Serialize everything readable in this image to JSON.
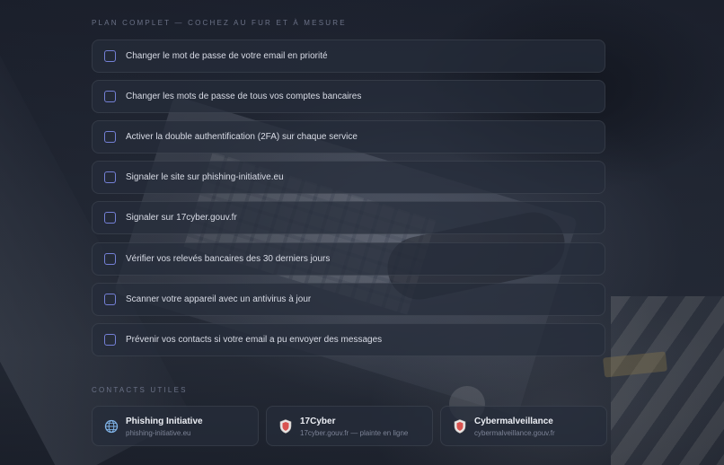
{
  "plan": {
    "title": "PLAN COMPLET — COCHEZ AU FUR ET À MESURE",
    "tasks": [
      {
        "label": "Changer le mot de passe de votre email en priorité",
        "checked": false
      },
      {
        "label": "Changer les mots de passe de tous vos comptes bancaires",
        "checked": false
      },
      {
        "label": "Activer la double authentification (2FA) sur chaque service",
        "checked": false
      },
      {
        "label": "Signaler le site sur phishing-initiative.eu",
        "checked": false
      },
      {
        "label": "Signaler sur 17cyber.gouv.fr",
        "checked": false
      },
      {
        "label": "Vérifier vos relevés bancaires des 30 derniers jours",
        "checked": false
      },
      {
        "label": "Scanner votre appareil avec un antivirus à jour",
        "checked": false
      },
      {
        "label": "Prévenir vos contacts si votre email a pu envoyer des messages",
        "checked": false
      }
    ]
  },
  "contacts": {
    "title": "CONTACTS UTILES",
    "items": [
      {
        "name": "Phishing Initiative",
        "sub": "phishing-initiative.eu",
        "icon": "globe-icon"
      },
      {
        "name": "17Cyber",
        "sub": "17cyber.gouv.fr — plainte en ligne",
        "icon": "shield-icon"
      },
      {
        "name": "Cybermalveillance",
        "sub": "cybermalveillance.gouv.fr",
        "icon": "shield-icon"
      }
    ]
  },
  "colors": {
    "checkbox_border": "#7480d6",
    "accent_red": "#d9534f",
    "globe_blue": "#7fb2e6"
  }
}
